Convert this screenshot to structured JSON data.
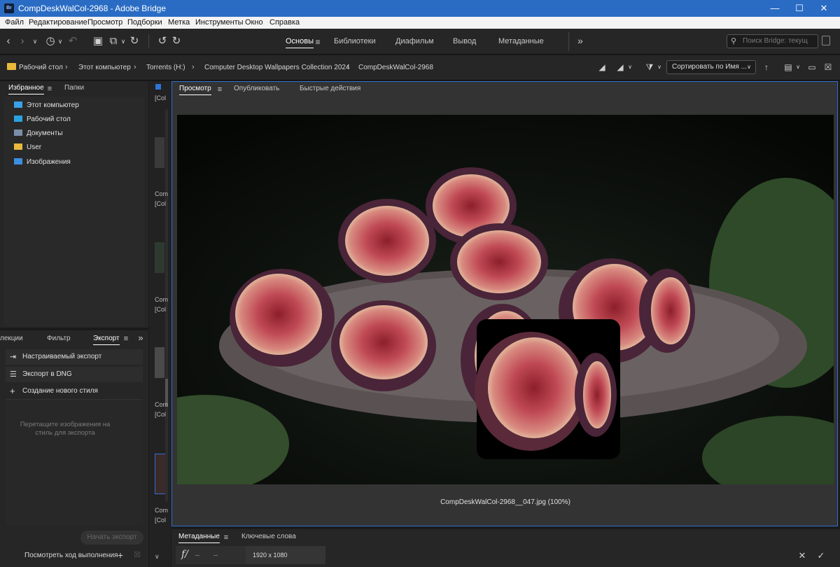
{
  "window": {
    "title": "CompDeskWalCol-2968 - Adobe Bridge",
    "logo": "Br",
    "minimize": "—",
    "maximize": "☐",
    "close": "✕"
  },
  "menu": [
    "Файл",
    "Редактирование",
    "Просмотр",
    "Подборки",
    "Метка",
    "Инструменты",
    "Окно",
    "Справка"
  ],
  "workspaces": {
    "items": [
      "Основы",
      "Библиотеки",
      "Диафильм",
      "Вывод",
      "Метаданные"
    ],
    "more": "»"
  },
  "search": {
    "placeholder": "Поиск Bridge: текущ"
  },
  "breadcrumb": [
    "Рабочий стол",
    "Этот компьютер",
    "Torrents (H:)",
    "Computer Desktop Wallpapers Collection 2024",
    "CompDeskWalCol-2968"
  ],
  "sort": {
    "label": "Сортировать по Имя ..."
  },
  "left_top": {
    "tabs": [
      "Избранное",
      "Папки"
    ],
    "favorites": [
      {
        "label": "Этот компьютер",
        "icon": "computer-icon",
        "color": "#3aa0e8"
      },
      {
        "label": "Рабочий стол",
        "icon": "desktop-icon",
        "color": "#29a3e0"
      },
      {
        "label": "Документы",
        "icon": "documents-icon",
        "color": "#7a8ea8"
      },
      {
        "label": "User",
        "icon": "folder-icon",
        "color": "#e8b93c"
      },
      {
        "label": "Изображения",
        "icon": "pictures-icon",
        "color": "#3c8ee0"
      }
    ]
  },
  "left_bottom": {
    "tabs": [
      "лекции",
      "Фильтр",
      "Экспорт"
    ],
    "items": [
      {
        "label": "Настраиваемый экспорт",
        "icon": "export-icon",
        "glyph": "⇥"
      },
      {
        "label": "Экспорт в DNG",
        "icon": "list-icon",
        "glyph": "☰"
      },
      {
        "label": "Создание нового стиля",
        "icon": "plus-icon",
        "glyph": "+"
      }
    ],
    "hint_line1": "Перетащите изображения на",
    "hint_line2": "стиль для экспорта",
    "start_button": "Начать экспорт",
    "progress_link": "Посмотреть ход выполнения"
  },
  "thumbs": {
    "lines": [
      "Com",
      "[Col"
    ]
  },
  "preview": {
    "tabs": [
      "Просмотр",
      "Опубликовать",
      "Быстрые действия"
    ],
    "caption": "CompDeskWalCol-2968__047.jpg (100%)"
  },
  "metadata": {
    "tabs": [
      "Метаданные",
      "Ключевые слова"
    ],
    "aperture_icon": "f/",
    "aperture": "--",
    "shutter": "--",
    "dimensions": "1920 x 1080"
  }
}
